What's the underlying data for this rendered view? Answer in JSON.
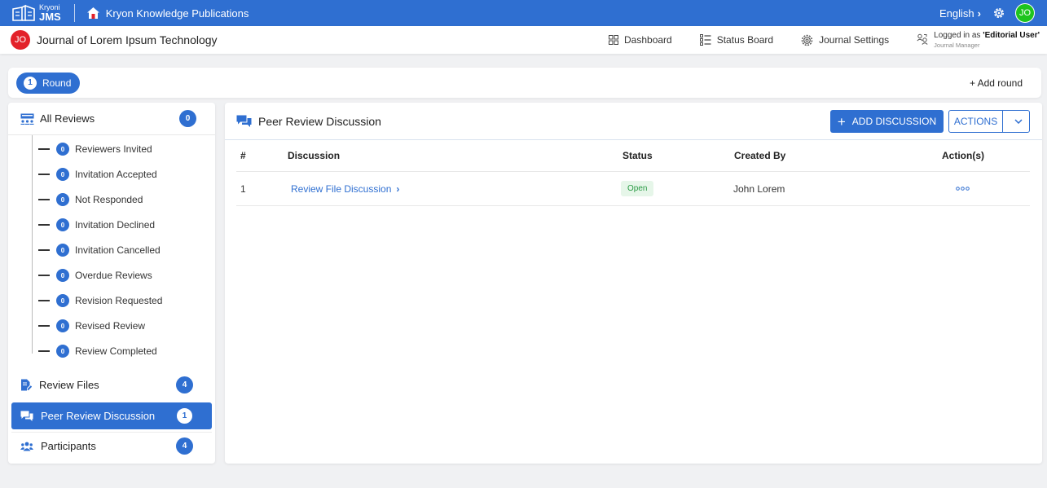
{
  "appbar": {
    "logo_top": "Kryoni",
    "logo_bottom": "JMS",
    "org_name": "Kryon Knowledge Publications",
    "language": "English",
    "user_initials": "JO"
  },
  "journal": {
    "initials": "JO",
    "title": "Journal of Lorem Ipsum Technology",
    "nav": {
      "dashboard": "Dashboard",
      "status_board": "Status Board",
      "journal_settings": "Journal Settings"
    },
    "login_prefix": "Logged in as ",
    "login_user": "'Editorial User'",
    "login_role": "Journal Manager"
  },
  "round": {
    "number": "1",
    "label": "Round",
    "add_label": "+ Add round"
  },
  "sidebar": {
    "all_reviews": {
      "label": "All Reviews",
      "count": "0"
    },
    "sub_items": [
      {
        "label": "Reviewers Invited",
        "count": "0"
      },
      {
        "label": "Invitation Accepted",
        "count": "0"
      },
      {
        "label": "Not Responded",
        "count": "0"
      },
      {
        "label": "Invitation Declined",
        "count": "0"
      },
      {
        "label": "Invitation Cancelled",
        "count": "0"
      },
      {
        "label": "Overdue Reviews",
        "count": "0"
      },
      {
        "label": "Revision Requested",
        "count": "0"
      },
      {
        "label": "Revised Review",
        "count": "0"
      },
      {
        "label": "Review Completed",
        "count": "0"
      }
    ],
    "review_files": {
      "label": "Review Files",
      "count": "4"
    },
    "peer_review": {
      "label": "Peer Review Discussion",
      "count": "1"
    },
    "participants": {
      "label": "Participants",
      "count": "4"
    }
  },
  "main": {
    "title": "Peer Review Discussion",
    "add_button": "ADD DISCUSSION",
    "actions_button": "ACTIONS",
    "columns": [
      "#",
      "Discussion",
      "Status",
      "Created By",
      "Action(s)"
    ],
    "rows": [
      {
        "num": "1",
        "discussion": "Review File Discussion",
        "status": "Open",
        "created_by": "John Lorem"
      }
    ]
  },
  "colors": {
    "primary": "#2f6fd1",
    "avatar_green": "#1ec41e",
    "avatar_red": "#e3222a",
    "status_open_bg": "#e6f6e9",
    "status_open_text": "#2a9b45"
  }
}
